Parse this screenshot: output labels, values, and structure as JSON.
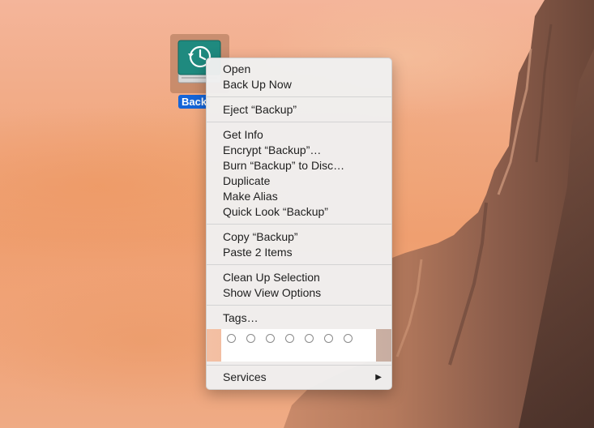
{
  "desktop": {
    "drive": {
      "label": "Back",
      "icon": "time-machine-drive-icon"
    }
  },
  "menu": {
    "groups": [
      [
        "Open",
        "Back Up Now"
      ],
      [
        "Eject “Backup”"
      ],
      [
        "Get Info",
        "Encrypt “Backup”…",
        "Burn “Backup” to Disc…",
        "Duplicate",
        "Make Alias",
        "Quick Look “Backup”"
      ],
      [
        "Copy “Backup”",
        "Paste 2 Items"
      ],
      [
        "Clean Up Selection",
        "Show View Options"
      ],
      [
        "Tags…"
      ]
    ],
    "tag_colors_count_visible": 7,
    "services": {
      "label": "Services",
      "arrow": "▶"
    }
  },
  "colors": {
    "selection": "#1565d8",
    "drive_teal": "#1f8a7f"
  }
}
